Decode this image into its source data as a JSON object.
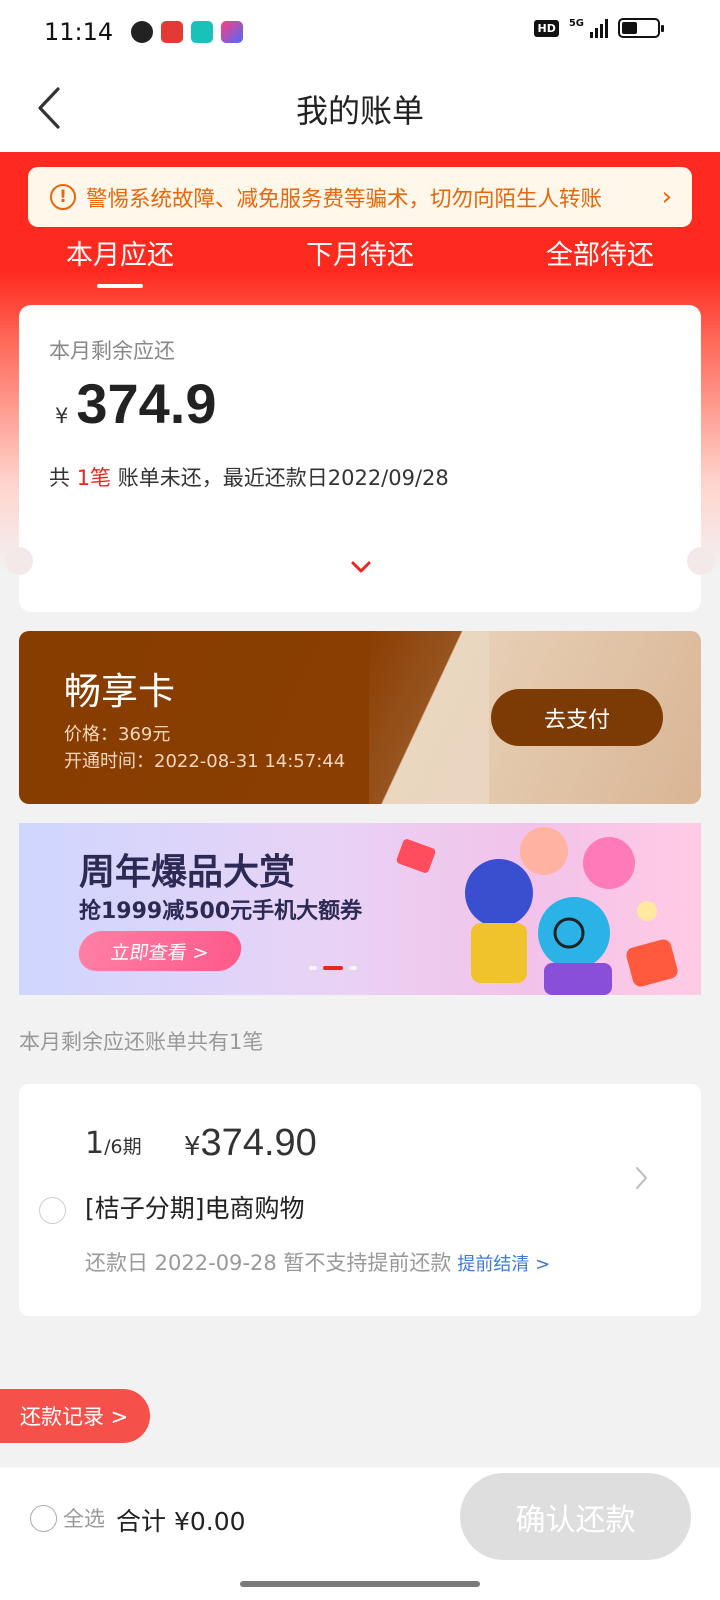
{
  "status_bar": {
    "time": "11:14",
    "network": "5G",
    "hd": "HD",
    "battery_level": 0.45,
    "app_icons": [
      "uc-browser-icon",
      "baidu-icon",
      "boss-zhipin-icon",
      "video-app-icon"
    ]
  },
  "nav": {
    "title": "我的账单"
  },
  "alert": {
    "text": "警惕系统故障、减免服务费等骗术，切勿向陌生人转账",
    "icon": "!"
  },
  "tabs": [
    {
      "label": "本月应还",
      "active": true
    },
    {
      "label": "下月待还",
      "active": false
    },
    {
      "label": "全部待还",
      "active": false
    }
  ],
  "summary": {
    "label": "本月剩余应还",
    "currency": "¥",
    "amount": "374.9",
    "desc_prefix": "共 ",
    "count": "1笔",
    "desc_suffix": " 账单未还，最近还款日2022/09/28"
  },
  "vip_card": {
    "title": "畅享卡",
    "price": "价格：369元",
    "open_time": "开通时间：2022-08-31 14:57:44",
    "pay_label": "去支付"
  },
  "banner": {
    "title": "周年爆品大赏",
    "subtitle": "抢1999减500元手机大额券",
    "button": "立即查看 >"
  },
  "section_caption": "本月剩余应还账单共有1笔",
  "bill": {
    "period_current": "1",
    "period_total": "/6期",
    "currency": "¥",
    "amount": "374.90",
    "name": "[桔子分期]电商购物",
    "meta": "还款日 2022-09-28 暂不支持提前还款",
    "early_link": "提前结清 >"
  },
  "record_pill": "还款记录 >",
  "bottom_bar": {
    "select_all": "全选",
    "total": "合计 ¥0.00",
    "confirm": "确认还款"
  },
  "colors": {
    "brand_red": "#ff2a1f",
    "alert_orange": "#e8660c",
    "vip_brown": "#883d00",
    "link_blue": "#3c78d8",
    "disabled_grey": "#dedede"
  }
}
